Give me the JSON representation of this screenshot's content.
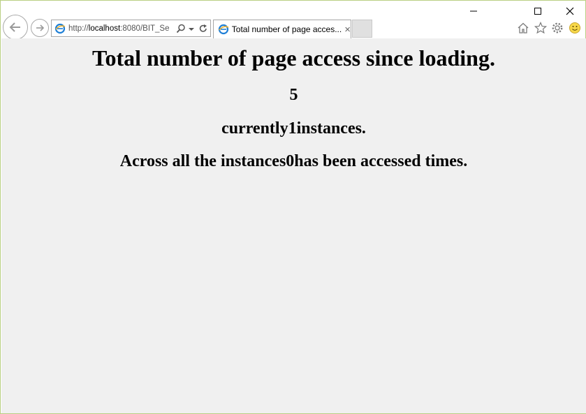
{
  "browser": {
    "address_prefix": "http://",
    "address_host": "localhost",
    "address_rest": ":8080/BIT_Se",
    "tab_title": "Total number of page acces...",
    "tab_close": "×"
  },
  "page": {
    "heading": "Total number of page access since loading.",
    "count": "5",
    "instances_line": "currently1instances.",
    "across_line": "Across all the instances0has been accessed times."
  }
}
